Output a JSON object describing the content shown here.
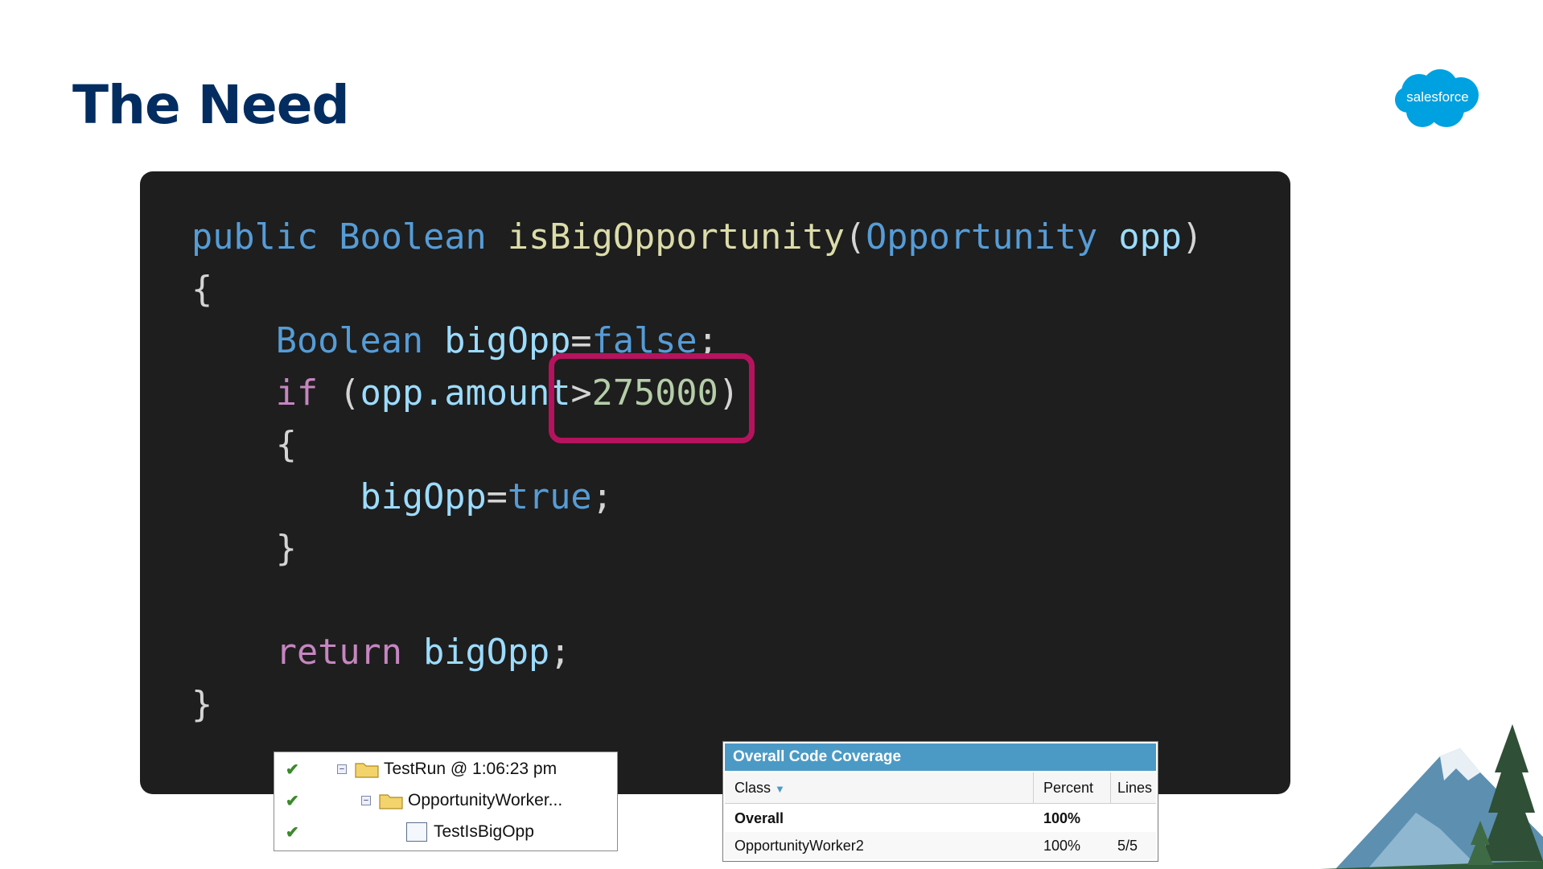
{
  "slide": {
    "title": "The Need",
    "logo_text": "salesforce"
  },
  "code": {
    "lines": [
      "public Boolean isBigOpportunity(Opportunity opp)",
      "{",
      "    Boolean bigOpp=false;",
      "    if (opp.amount>275000)",
      "    {",
      "        bigOpp=true;",
      "    }",
      "",
      "    return bigOpp;",
      "}"
    ],
    "highlighted_text": ">275000)"
  },
  "test_run": {
    "items": [
      {
        "label": "TestRun @ 1:06:23 pm",
        "status": "check-icon"
      },
      {
        "label": "OpportunityWorker...",
        "status": "check-icon"
      },
      {
        "label": "TestIsBigOpp",
        "status": "check-icon"
      }
    ]
  },
  "coverage": {
    "header": "Overall Code Coverage",
    "columns": {
      "class": "Class",
      "percent": "Percent",
      "lines": "Lines"
    },
    "rows": [
      {
        "class": "Overall",
        "percent": "100%",
        "lines": ""
      },
      {
        "class": "OpportunityWorker2",
        "percent": "100%",
        "lines": "5/5"
      }
    ]
  },
  "colors": {
    "title": "#032d60",
    "brand": "#00a1e0",
    "highlight": "#b5135d",
    "coverage_header": "#4b9ac6"
  }
}
